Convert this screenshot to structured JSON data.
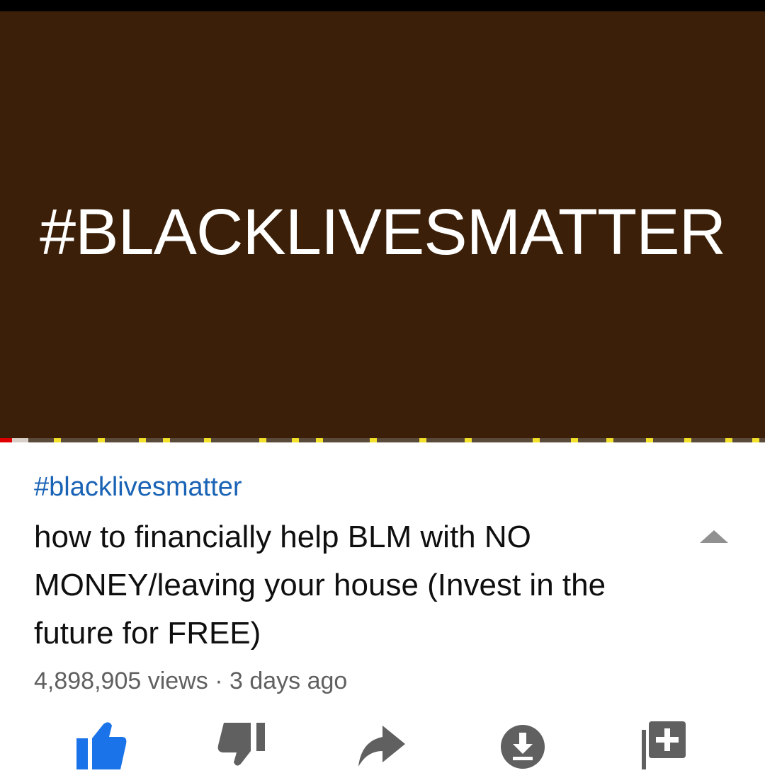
{
  "player": {
    "overlay_text": "#BLACKLIVESMATTER",
    "background_color": "#3b1f08",
    "progress_played_fraction": 0.016,
    "progress_buffered_fraction": 0.037
  },
  "video": {
    "hashtag": "#blacklivesmatter",
    "title": "how to financially help BLM with NO MONEY/leaving your house (Invest in the future for FREE)",
    "views": "4,898,905 views",
    "separator": "·",
    "age": "3 days ago"
  },
  "actions": [
    {
      "name": "like",
      "icon": "thumbs-up-icon",
      "active": true
    },
    {
      "name": "dislike",
      "icon": "thumbs-down-icon",
      "active": false
    },
    {
      "name": "share",
      "icon": "share-arrow-icon",
      "active": false
    },
    {
      "name": "download",
      "icon": "download-icon",
      "active": false
    },
    {
      "name": "save",
      "icon": "add-to-playlist-icon",
      "active": false
    }
  ],
  "colors": {
    "link": "#1a63b5",
    "like_active": "#1a73e8",
    "icon_inactive": "#606060",
    "ad_marker": "#f2e02a",
    "progress": "#e00000"
  }
}
